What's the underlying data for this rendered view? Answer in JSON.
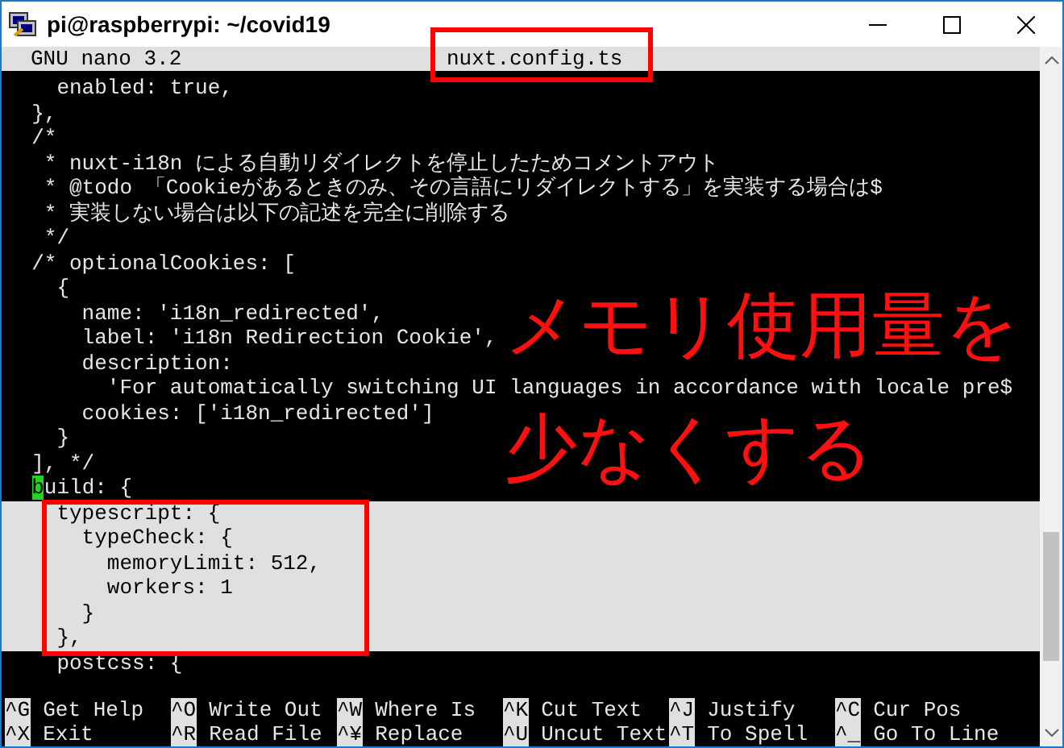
{
  "window": {
    "title": "pi@raspberrypi: ~/covid19"
  },
  "editor": {
    "app": "GNU nano 3.2",
    "filename": "nuxt.config.ts",
    "lines": [
      {
        "text": "    enabled: true,",
        "highlighted": false,
        "cursor": false
      },
      {
        "text": "  },",
        "highlighted": false,
        "cursor": false
      },
      {
        "text": "  /*",
        "highlighted": false,
        "cursor": false
      },
      {
        "text": "   * nuxt-i18n による自動リダイレクトを停止したためコメントアウト",
        "highlighted": false,
        "cursor": false
      },
      {
        "text": "   * @todo 「Cookieがあるときのみ、その言語にリダイレクトする」を実装する場合は$",
        "highlighted": false,
        "cursor": false
      },
      {
        "text": "   * 実装しない場合は以下の記述を完全に削除する",
        "highlighted": false,
        "cursor": false
      },
      {
        "text": "   */",
        "highlighted": false,
        "cursor": false
      },
      {
        "text": "  /* optionalCookies: [",
        "highlighted": false,
        "cursor": false
      },
      {
        "text": "    {",
        "highlighted": false,
        "cursor": false
      },
      {
        "text": "      name: 'i18n_redirected',",
        "highlighted": false,
        "cursor": false
      },
      {
        "text": "      label: 'i18n Redirection Cookie',",
        "highlighted": false,
        "cursor": false
      },
      {
        "text": "      description:",
        "highlighted": false,
        "cursor": false
      },
      {
        "text": "        'For automatically switching UI languages in accordance with locale pre$",
        "highlighted": false,
        "cursor": false
      },
      {
        "text": "      cookies: ['i18n_redirected']",
        "highlighted": false,
        "cursor": false
      },
      {
        "text": "    }",
        "highlighted": false,
        "cursor": false
      },
      {
        "text": "  ], */",
        "highlighted": false,
        "cursor": false
      },
      {
        "text": "  build: {",
        "highlighted": false,
        "cursor": true
      },
      {
        "text": "    typescript: {",
        "highlighted": true,
        "cursor": false
      },
      {
        "text": "      typeCheck: {",
        "highlighted": true,
        "cursor": false
      },
      {
        "text": "        memoryLimit: 512,",
        "highlighted": true,
        "cursor": false
      },
      {
        "text": "        workers: 1",
        "highlighted": true,
        "cursor": false
      },
      {
        "text": "      }",
        "highlighted": true,
        "cursor": false
      },
      {
        "text": "    },",
        "highlighted": true,
        "cursor": false
      },
      {
        "text": "    postcss: {",
        "highlighted": false,
        "cursor": false
      }
    ]
  },
  "shortcuts": [
    [
      {
        "key": "^G",
        "label": "Get Help"
      },
      {
        "key": "^O",
        "label": "Write Out"
      },
      {
        "key": "^W",
        "label": "Where Is"
      },
      {
        "key": "^K",
        "label": "Cut Text"
      },
      {
        "key": "^J",
        "label": "Justify"
      },
      {
        "key": "^C",
        "label": "Cur Pos"
      }
    ],
    [
      {
        "key": "^X",
        "label": "Exit"
      },
      {
        "key": "^R",
        "label": "Read File"
      },
      {
        "key": "^¥",
        "label": "Replace"
      },
      {
        "key": "^U",
        "label": "Uncut Text"
      },
      {
        "key": "^T",
        "label": "To Spell"
      },
      {
        "key": "^_",
        "label": "Go To Line"
      }
    ]
  ],
  "annotation": {
    "caption": [
      "メモリ使用量を",
      "少なくする"
    ]
  }
}
